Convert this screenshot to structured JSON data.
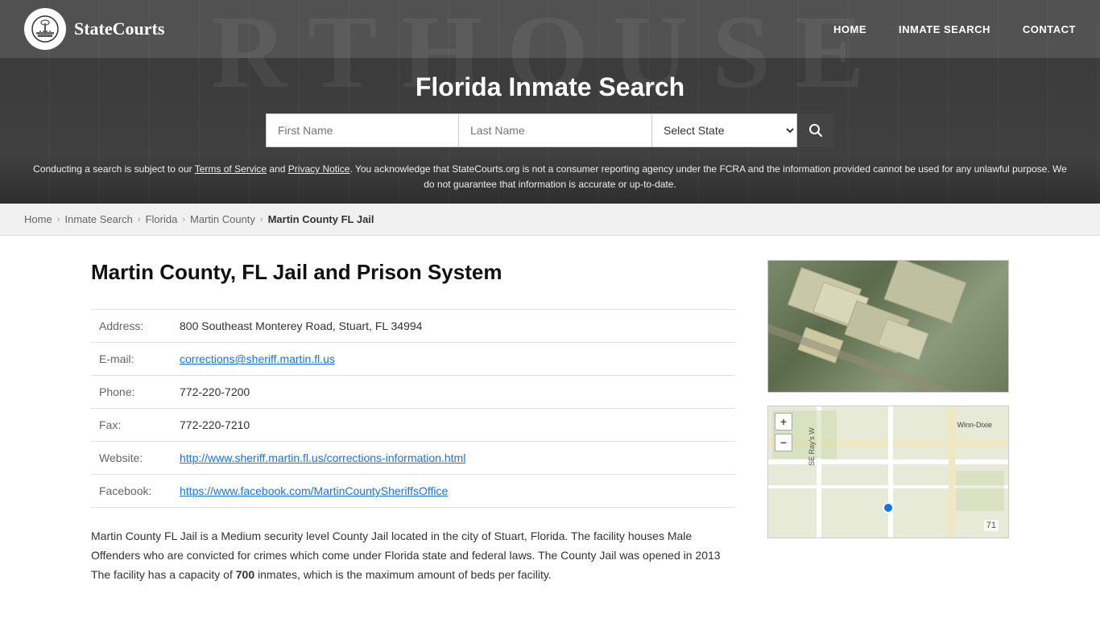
{
  "site": {
    "name": "StateCourts",
    "logo_icon": "🏛"
  },
  "nav": {
    "home_label": "HOME",
    "inmate_search_label": "INMATE SEARCH",
    "contact_label": "CONTACT"
  },
  "hero": {
    "title": "Florida Inmate Search"
  },
  "search": {
    "first_name_placeholder": "First Name",
    "last_name_placeholder": "Last Name",
    "state_label": "Select State",
    "search_icon": "🔍"
  },
  "disclaimer": {
    "text_before": "Conducting a search is subject to our ",
    "terms_label": "Terms of Service",
    "and": " and ",
    "privacy_label": "Privacy Notice",
    "text_after": ". You acknowledge that StateCourts.org is not a consumer reporting agency under the FCRA and the information provided cannot be used for any unlawful purpose. We do not guarantee that information is accurate or up-to-date."
  },
  "breadcrumb": {
    "home": "Home",
    "inmate_search": "Inmate Search",
    "state": "Florida",
    "county": "Martin County",
    "current": "Martin County FL Jail"
  },
  "page": {
    "title": "Martin County, FL Jail and Prison System",
    "info": {
      "address_label": "Address:",
      "address_value": "800 Southeast Monterey Road, Stuart, FL 34994",
      "email_label": "E-mail:",
      "email_value": "corrections@sheriff.martin.fl.us",
      "phone_label": "Phone:",
      "phone_value": "772-220-7200",
      "fax_label": "Fax:",
      "fax_value": "772-220-7210",
      "website_label": "Website:",
      "website_value": "http://www.sheriff.martin.fl.us/corrections-information.html",
      "facebook_label": "Facebook:",
      "facebook_value": "https://www.facebook.com/MartinCountySheriffsOffice"
    },
    "description": "Martin County FL Jail is a Medium security level County Jail located in the city of Stuart, Florida. The facility houses Male Offenders who are convicted for crimes which come under Florida state and federal laws. The County Jail was opened in 2013 The facility has a capacity of ",
    "capacity": "700",
    "description_end": " inmates, which is the maximum amount of beds per facility."
  },
  "map": {
    "zoom_in": "+",
    "zoom_out": "−",
    "nearby_label": "Winn-Dixie",
    "route_number": "71"
  }
}
